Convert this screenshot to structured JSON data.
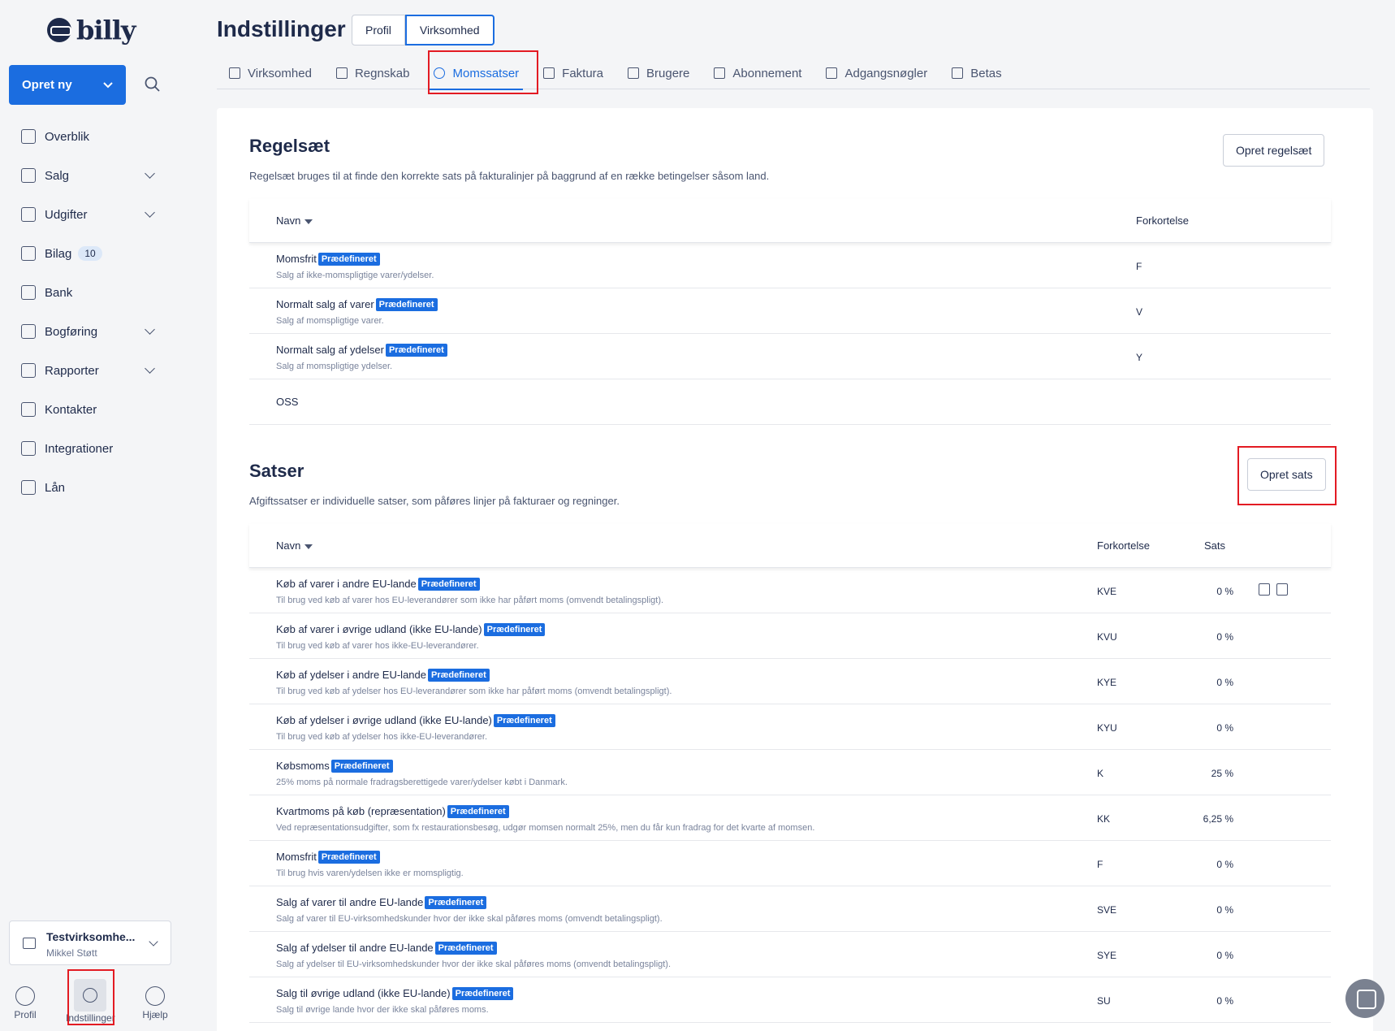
{
  "sidebar": {
    "logo_text": "billy",
    "create_label": "Opret ny",
    "nav": [
      {
        "label": "Overblik",
        "icon": "presentation-icon",
        "expandable": false
      },
      {
        "label": "Salg",
        "icon": "cart-icon",
        "expandable": true
      },
      {
        "label": "Udgifter",
        "icon": "receipts-icon",
        "expandable": true
      },
      {
        "label": "Bilag",
        "icon": "image-icon",
        "expandable": false,
        "badge": "10"
      },
      {
        "label": "Bank",
        "icon": "bank-icon",
        "expandable": false
      },
      {
        "label": "Bogføring",
        "icon": "calculator-icon",
        "expandable": true
      },
      {
        "label": "Rapporter",
        "icon": "report-icon",
        "expandable": true
      },
      {
        "label": "Kontakter",
        "icon": "contact-icon",
        "expandable": false
      },
      {
        "label": "Integrationer",
        "icon": "puzzle-icon",
        "expandable": false
      },
      {
        "label": "Lån",
        "icon": "money-bag-icon",
        "expandable": false
      }
    ],
    "company": {
      "name": "Testvirksomhe...",
      "user": "Mikkel Støtt"
    },
    "bottom": [
      {
        "label": "Profil",
        "icon": "user-icon"
      },
      {
        "label": "Indstillinger",
        "icon": "gear-icon"
      },
      {
        "label": "Hjælp",
        "icon": "help-icon"
      }
    ]
  },
  "header": {
    "title": "Indstillinger",
    "segments": [
      "Profil",
      "Virksomhed"
    ],
    "tabs": [
      {
        "label": "Virksomhed",
        "icon": "briefcase-icon"
      },
      {
        "label": "Regnskab",
        "icon": "bar-chart-icon"
      },
      {
        "label": "Momssatser",
        "icon": "pie-chart-icon",
        "active": true
      },
      {
        "label": "Faktura",
        "icon": "invoice-icon"
      },
      {
        "label": "Brugere",
        "icon": "users-icon"
      },
      {
        "label": "Abonnement",
        "icon": "subscription-icon"
      },
      {
        "label": "Adgangsnøgler",
        "icon": "share-icon"
      },
      {
        "label": "Betas",
        "icon": "lightbulb-icon"
      }
    ]
  },
  "rulesets": {
    "title": "Regelsæt",
    "description": "Regelsæt bruges til at finde den korrekte sats på fakturalinjer på baggrund af en række betingelser såsom land.",
    "create_label": "Opret regelsæt",
    "col_name": "Navn",
    "col_abbr": "Forkortelse",
    "badge": "Prædefineret",
    "rows": [
      {
        "name": "Momsfrit",
        "predefined": true,
        "desc": "Salg af ikke-momspligtige varer/ydelser.",
        "abbr": "F"
      },
      {
        "name": "Normalt salg af varer",
        "predefined": true,
        "desc": "Salg af momspligtige varer.",
        "abbr": "V"
      },
      {
        "name": "Normalt salg af ydelser",
        "predefined": true,
        "desc": "Salg af momspligtige ydelser.",
        "abbr": "Y"
      },
      {
        "name": "OSS",
        "predefined": false,
        "desc": "",
        "abbr": ""
      }
    ]
  },
  "rates": {
    "title": "Satser",
    "description": "Afgiftssatser er individuelle satser, som påføres linjer på fakturaer og regninger.",
    "create_label": "Opret sats",
    "col_name": "Navn",
    "col_abbr": "Forkortelse",
    "col_rate": "Sats",
    "badge": "Prædefineret",
    "rows": [
      {
        "name": "Køb af varer i andre EU-lande",
        "desc": "Til brug ved køb af varer hos EU-leverandører som ikke har påført moms (omvendt betalingspligt).",
        "abbr": "KVE",
        "rate": "0 %"
      },
      {
        "name": "Køb af varer i øvrige udland (ikke EU-lande)",
        "desc": "Til brug ved køb af varer hos ikke-EU-leverandører.",
        "abbr": "KVU",
        "rate": "0 %"
      },
      {
        "name": "Køb af ydelser i andre EU-lande",
        "desc": "Til brug ved køb af ydelser hos EU-leverandører som ikke har påført moms (omvendt betalingspligt).",
        "abbr": "KYE",
        "rate": "0 %"
      },
      {
        "name": "Køb af ydelser i øvrige udland (ikke EU-lande)",
        "desc": "Til brug ved køb af ydelser hos ikke-EU-leverandører.",
        "abbr": "KYU",
        "rate": "0 %"
      },
      {
        "name": "Købsmoms",
        "desc": "25% moms på normale fradragsberettigede varer/ydelser købt i Danmark.",
        "abbr": "K",
        "rate": "25 %"
      },
      {
        "name": "Kvartmoms på køb (repræsentation)",
        "desc": "Ved repræsentationsudgifter, som fx restaurationsbesøg, udgør momsen normalt 25%, men du får kun fradrag for det kvarte af momsen.",
        "abbr": "KK",
        "rate": "6,25 %"
      },
      {
        "name": "Momsfrit",
        "desc": "Til brug hvis varen/ydelsen ikke er momspligtig.",
        "abbr": "F",
        "rate": "0 %"
      },
      {
        "name": "Salg af varer til andre EU-lande",
        "desc": "Salg af varer til EU-virksomhedskunder hvor der ikke skal påføres moms (omvendt betalingspligt).",
        "abbr": "SVE",
        "rate": "0 %"
      },
      {
        "name": "Salg af ydelser til andre EU-lande",
        "desc": "Salg af ydelser til EU-virksomhedskunder hvor der ikke skal påføres moms (omvendt betalingspligt).",
        "abbr": "SYE",
        "rate": "0 %"
      },
      {
        "name": "Salg til øvrige udland (ikke EU-lande)",
        "desc": "Salg til øvrige lande hvor der ikke skal påføres moms.",
        "abbr": "SU",
        "rate": "0 %"
      }
    ]
  },
  "colors": {
    "accent": "#1b6de0",
    "highlight": "#e31b23",
    "text": "#1e2a4a"
  }
}
